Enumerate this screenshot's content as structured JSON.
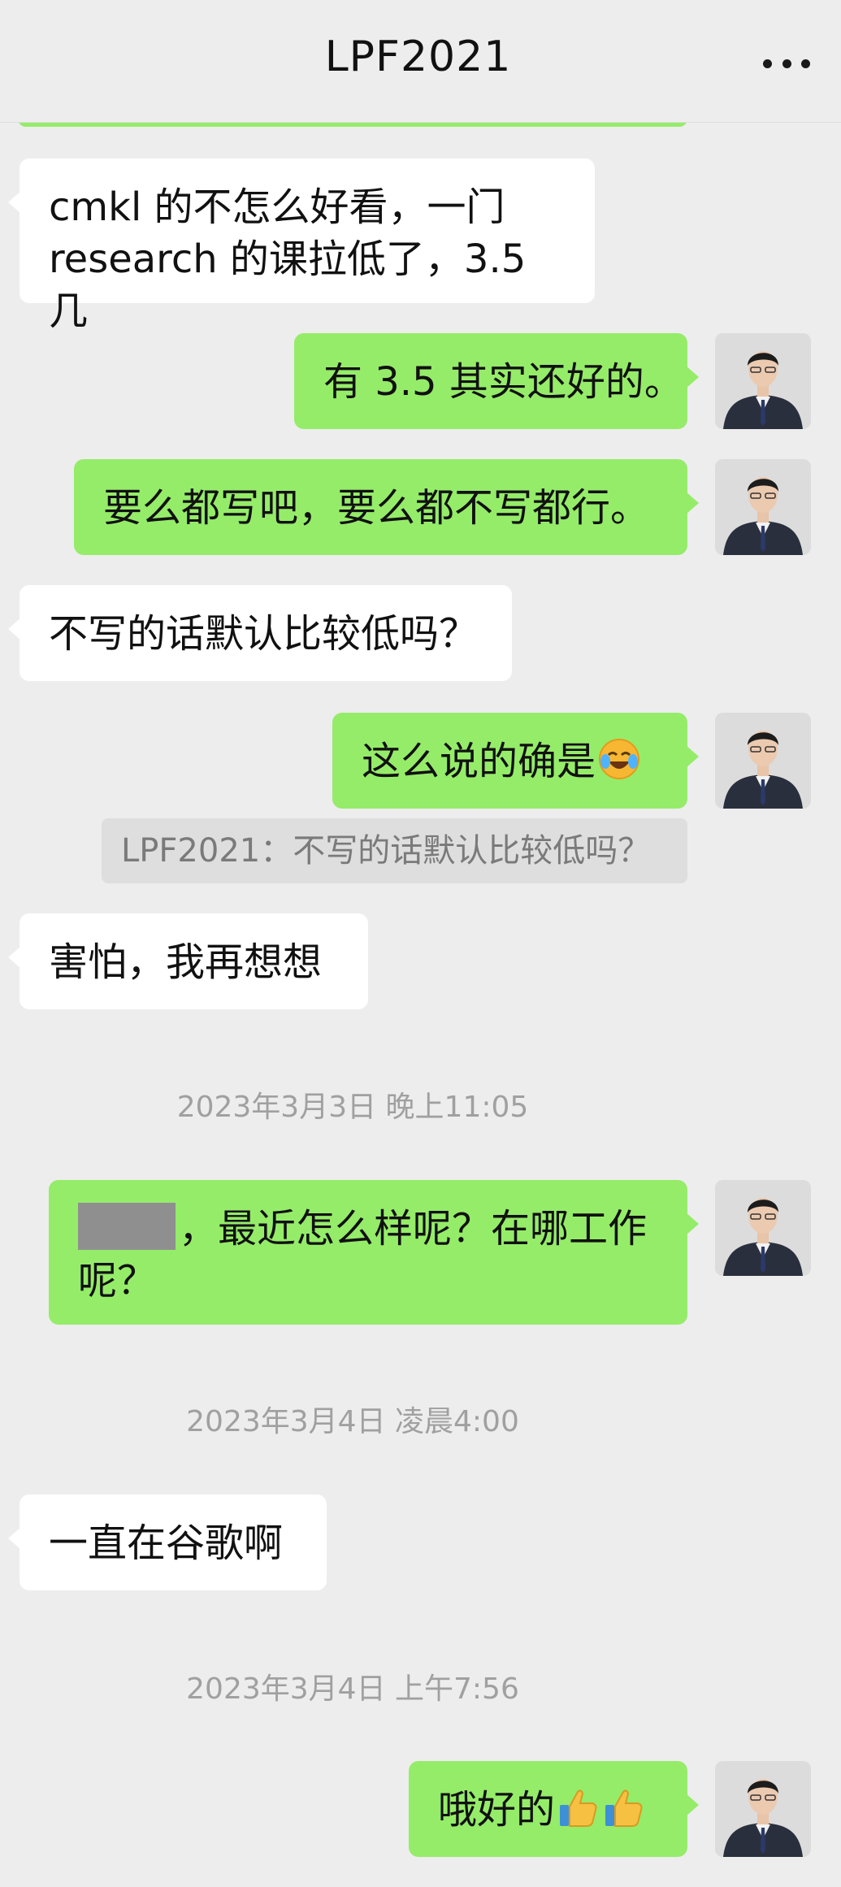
{
  "header": {
    "title": "LPF2021"
  },
  "messages": [
    {
      "text": "cmkl 的不怎么好看，一门 research 的课拉低了，3.5 几"
    },
    {
      "text": "有 3.5 其实还好的。"
    },
    {
      "text": "要么都写吧，要么都不写都行。"
    },
    {
      "text": "不写的话默认比较低吗？"
    },
    {
      "text": "这么说的确是"
    },
    {
      "quote": "LPF2021：不写的话默认比较低吗？"
    },
    {
      "text": "害怕，我再想想"
    },
    {
      "timestamp": "2023年3月3日 晚上11:05"
    },
    {
      "text": "，最近怎么样呢？在哪工作呢？"
    },
    {
      "timestamp": "2023年3月4日 凌晨4:00"
    },
    {
      "text": "一直在谷歌啊"
    },
    {
      "timestamp": "2023年3月4日 上午7:56"
    },
    {
      "text": "哦好的"
    }
  ],
  "icons": {
    "more": "more-dots-icon",
    "laugh_cry_emoji": "rolling-laughing-emoji",
    "thumbs_up_emoji": "thumbs-up-emoji"
  }
}
